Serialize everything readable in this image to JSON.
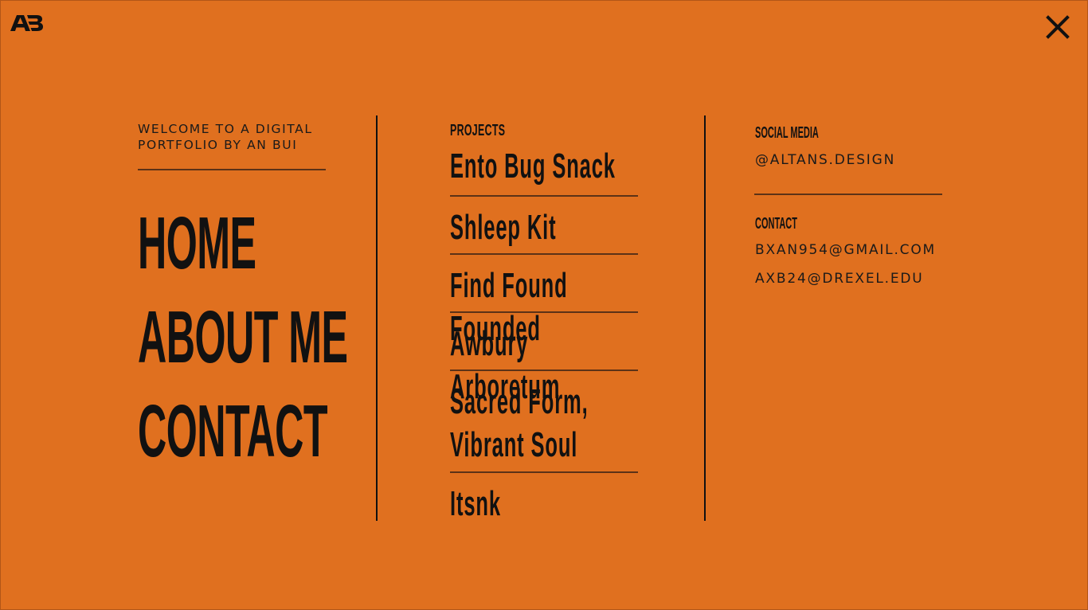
{
  "brand": {
    "logo_text": "AB"
  },
  "header": {
    "close_label": "Close menu"
  },
  "intro": {
    "line1": "WELCOME TO A DIGITAL",
    "line2": "PORTFOLIO BY AN BUI"
  },
  "main_nav": {
    "items": [
      {
        "label": "HOME"
      },
      {
        "label": "ABOUT ME"
      },
      {
        "label": "CONTACT"
      }
    ]
  },
  "projects": {
    "heading": "PROJECTS",
    "items": [
      {
        "label": "Ento Bug Snack"
      },
      {
        "label": "Shleep Kit"
      },
      {
        "label": "Find Found Founded"
      },
      {
        "label": "Awbury Arboretum"
      },
      {
        "label": "Sacred Form,\nVibrant Soul"
      },
      {
        "label": "Itsnk"
      }
    ]
  },
  "social": {
    "heading": "SOCIAL MEDIA",
    "handle": "@ALTANS.DESIGN"
  },
  "contact": {
    "heading": "CONTACT",
    "emails": [
      "BXAN954@GMAIL.COM",
      "AXB24@DREXEL.EDU"
    ]
  },
  "colors": {
    "background": "#e0701f",
    "text": "#141414",
    "divider": "#5c3217"
  },
  "icons": {
    "logo": "ab-logo-icon",
    "close": "close-icon"
  }
}
